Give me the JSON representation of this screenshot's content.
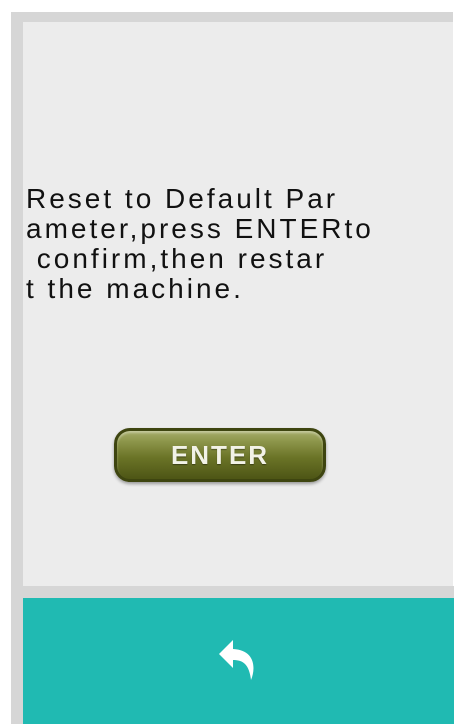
{
  "dialog": {
    "message_lines": [
      "Reset to Default Par",
      "ameter,press ENTERto",
      " confirm,then restar",
      "t the machine."
    ],
    "enter_label": "ENTER"
  },
  "footer": {
    "back_icon": "back-arrow-icon",
    "background_color": "#20bab2"
  },
  "colors": {
    "panel": "#ececec",
    "frame": "#d6d6d6",
    "button": "#6b7427",
    "accent": "#20bab2"
  }
}
